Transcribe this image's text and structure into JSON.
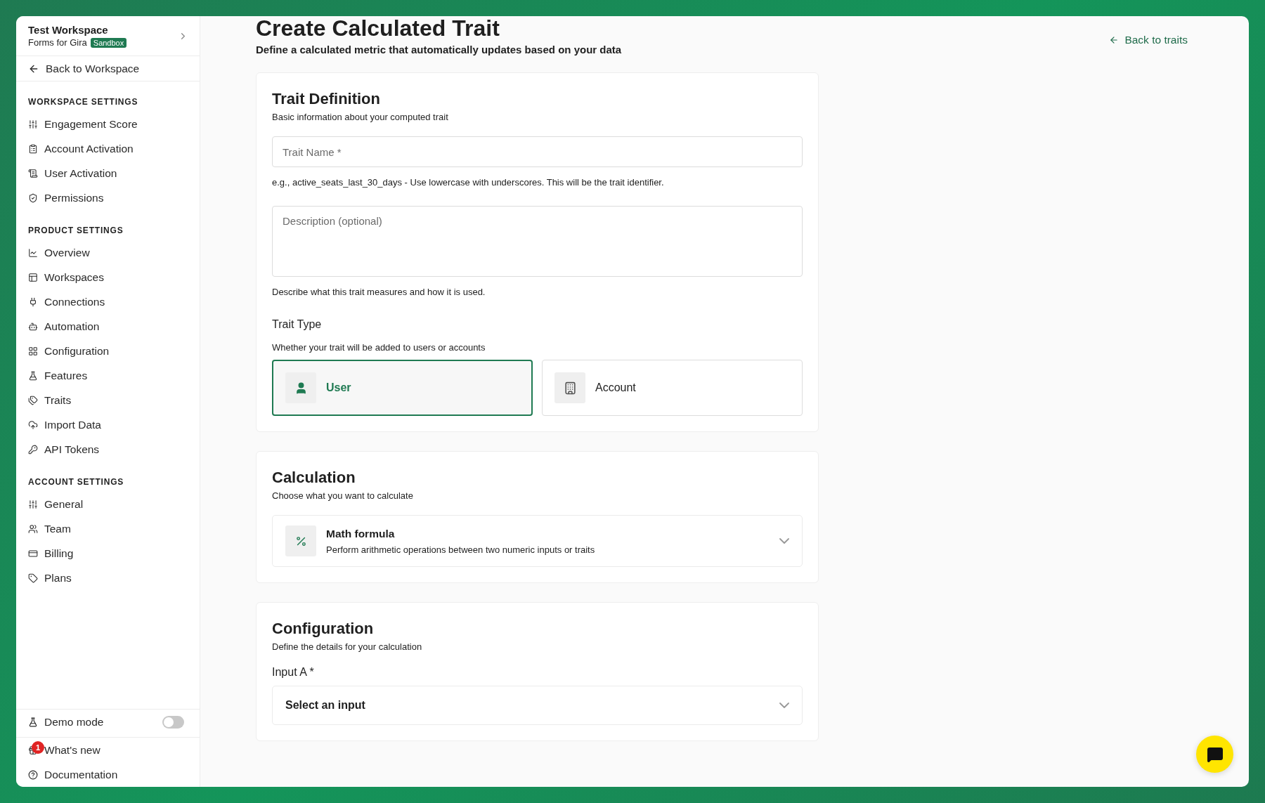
{
  "workspace": {
    "name": "Test Workspace",
    "org": "Forms for Gira",
    "badge": "Sandbox"
  },
  "back_to_workspace": "Back to Workspace",
  "sidebar": {
    "sections": [
      {
        "heading": "WORKSPACE SETTINGS",
        "items": [
          "Engagement Score",
          "Account Activation",
          "User Activation",
          "Permissions"
        ]
      },
      {
        "heading": "PRODUCT SETTINGS",
        "items": [
          "Overview",
          "Workspaces",
          "Connections",
          "Automation",
          "Configuration",
          "Features",
          "Traits",
          "Import Data",
          "API Tokens"
        ]
      },
      {
        "heading": "ACCOUNT SETTINGS",
        "items": [
          "General",
          "Team",
          "Billing",
          "Plans"
        ]
      }
    ]
  },
  "footer": {
    "demo_mode": {
      "label": "Demo mode",
      "on": false
    },
    "whats_new": {
      "label": "What's new",
      "badge": "1"
    },
    "documentation": "Documentation"
  },
  "page": {
    "title": "Create Calculated Trait",
    "subtitle": "Define a calculated metric that automatically updates based on your data",
    "back_link": "Back to traits"
  },
  "trait_definition": {
    "title": "Trait Definition",
    "subtitle": "Basic information about your computed trait",
    "name_field": {
      "placeholder": "Trait Name *"
    },
    "name_hint": "e.g., active_seats_last_30_days - Use lowercase with underscores. This will be the trait identifier.",
    "description_field": {
      "placeholder": "Description (optional)"
    },
    "description_hint": "Describe what this trait measures and how it is used.",
    "type_label": "Trait Type",
    "type_hint": "Whether your trait will be added to users or accounts",
    "type_options": [
      {
        "label": "User",
        "selected": true
      },
      {
        "label": "Account",
        "selected": false
      }
    ]
  },
  "calculation": {
    "title": "Calculation",
    "subtitle": "Choose what you want to calculate",
    "method": {
      "title": "Math formula",
      "description": "Perform arithmetic operations between two numeric inputs or traits"
    }
  },
  "configuration": {
    "title": "Configuration",
    "subtitle": "Define the details for your calculation",
    "input_a": {
      "label": "Input A *",
      "value": "Select an input"
    }
  }
}
